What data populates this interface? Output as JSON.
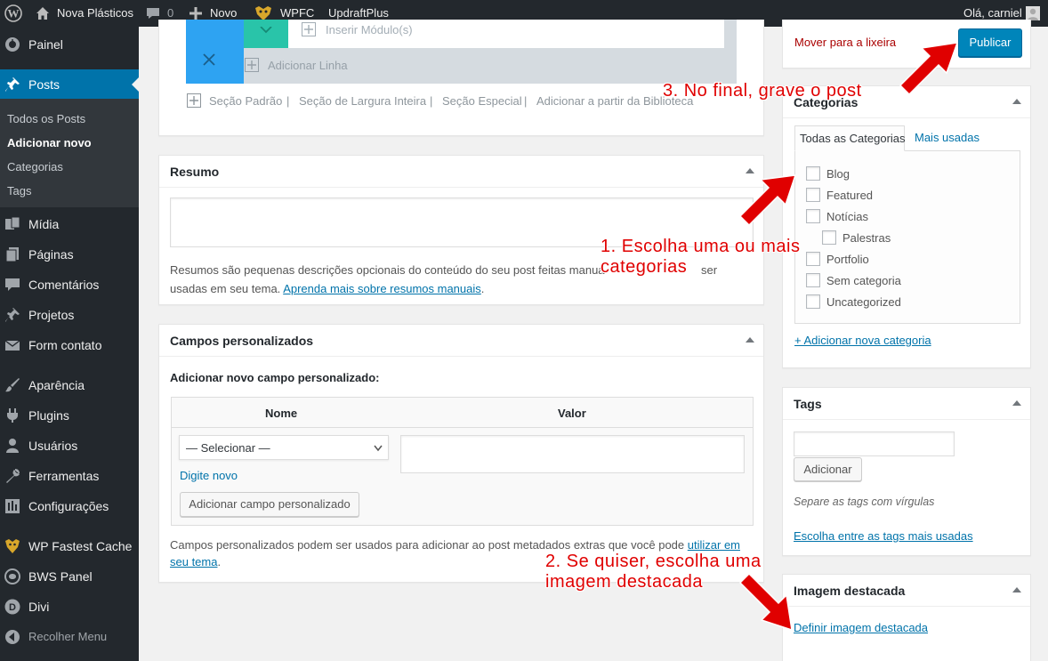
{
  "admin_bar": {
    "site_name": "Nova Plásticos",
    "comments_count": "0",
    "new_label": "Novo",
    "wpfc_label": "WPFC",
    "updraft_label": "UpdraftPlus",
    "greeting": "Olá, carniel"
  },
  "sidebar": {
    "items": [
      {
        "label": "Painel",
        "icon": "dashboard-icon"
      },
      {
        "label": "Posts",
        "icon": "pin-icon"
      },
      {
        "label": "Mídia",
        "icon": "media-icon"
      },
      {
        "label": "Páginas",
        "icon": "pages-icon"
      },
      {
        "label": "Comentários",
        "icon": "comment-icon"
      },
      {
        "label": "Projetos",
        "icon": "pin-icon"
      },
      {
        "label": "Form contato",
        "icon": "mail-icon"
      },
      {
        "label": "Aparência",
        "icon": "brush-icon"
      },
      {
        "label": "Plugins",
        "icon": "plugin-icon"
      },
      {
        "label": "Usuários",
        "icon": "user-icon"
      },
      {
        "label": "Ferramentas",
        "icon": "wrench-icon"
      },
      {
        "label": "Configurações",
        "icon": "settings-icon"
      },
      {
        "label": "WP Fastest Cache",
        "icon": "cheetah-icon"
      },
      {
        "label": "BWS Panel",
        "icon": "bws-icon"
      },
      {
        "label": "Divi",
        "icon": "divi-icon"
      },
      {
        "label": "Recolher Menu",
        "icon": "collapse-icon"
      }
    ],
    "submenu": [
      "Todos os Posts",
      "Adicionar novo",
      "Categorias",
      "Tags"
    ]
  },
  "builder": {
    "insert_module": "Inserir Módulo(s)",
    "add_row": "Adicionar Linha",
    "links": [
      "Seção Padrão",
      "Seção de Largura Inteira",
      "Seção Especial",
      "Adicionar a partir da Biblioteca"
    ],
    "separator": "|"
  },
  "resumo": {
    "title": "Resumo",
    "help_before": "Resumos são pequenas descrições opcionais do conteúdo do seu post feitas manua",
    "help_after": "ser",
    "help_line2": "usadas em seu tema.",
    "help_link": "Aprenda mais sobre resumos manuais",
    "help_end": "."
  },
  "custom_fields": {
    "title": "Campos personalizados",
    "add_new_label": "Adicionar novo campo personalizado:",
    "col_name": "Nome",
    "col_value": "Valor",
    "select_value": "— Selecionar —",
    "enter_new": "Digite novo",
    "add_button": "Adicionar campo personalizado",
    "help_text": "Campos personalizados podem ser usados para adicionar ao post metadados extras que você pode",
    "help_link_1": "utilizar em",
    "help_link_2": "seu tema",
    "help_end": "."
  },
  "publish": {
    "trash_link": "Mover para a lixeira",
    "publish_button": "Publicar"
  },
  "categories": {
    "title": "Categorias",
    "tab_all": "Todas as Categorias",
    "tab_popular": "Mais usadas",
    "items": [
      "Blog",
      "Featured",
      "Notícias",
      "Palestras",
      "Portfolio",
      "Sem categoria",
      "Uncategorized"
    ],
    "add_new": "+ Adicionar nova categoria"
  },
  "tags": {
    "title": "Tags",
    "add_button": "Adicionar",
    "hint": "Separe as tags com vírgulas",
    "choose_link": "Escolha entre as tags mais usadas"
  },
  "featured_image": {
    "title": "Imagem destacada",
    "set_link": "Definir imagem destacada"
  },
  "annotations": {
    "step1_line1": "1. Escolha uma ou mais",
    "step1_line2": "categorias",
    "step2_line1": "2. Se quiser, escolha uma",
    "step2_line2": "imagem destacada",
    "step3": "3. No final, grave o post"
  },
  "colors": {
    "admin_dark": "#23282d",
    "accent_blue": "#0073aa",
    "publish_blue": "#0085ba",
    "teal": "#2ea3f2",
    "annotation_red": "#e00000"
  }
}
